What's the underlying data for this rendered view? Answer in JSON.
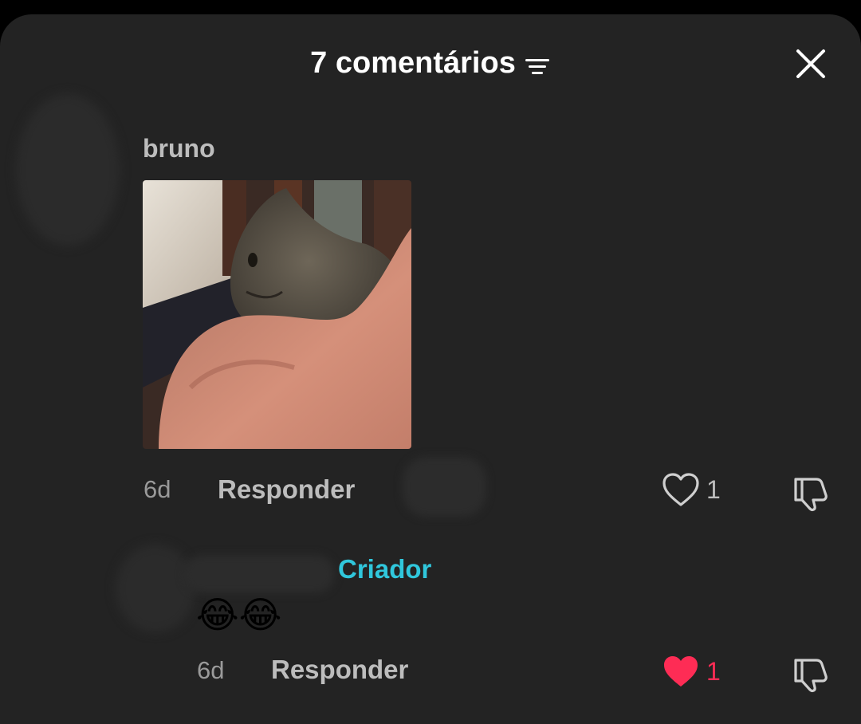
{
  "header": {
    "title": "7 comentários",
    "filter_icon": "filter-icon",
    "close_icon": "close-icon"
  },
  "comments": [
    {
      "username": "bruno",
      "image_alt": "cat photo",
      "time": "6d",
      "reply_label": "Responder",
      "likes": "1",
      "liked": false
    },
    {
      "badge": "Criador",
      "text": "😂😂",
      "time": "6d",
      "reply_label": "Responder",
      "likes": "1",
      "liked": true
    }
  ],
  "colors": {
    "background": "#232323",
    "creator_badge": "#30c7dc",
    "liked_heart": "#fe2c55",
    "muted_text": "#9a9a9a"
  }
}
